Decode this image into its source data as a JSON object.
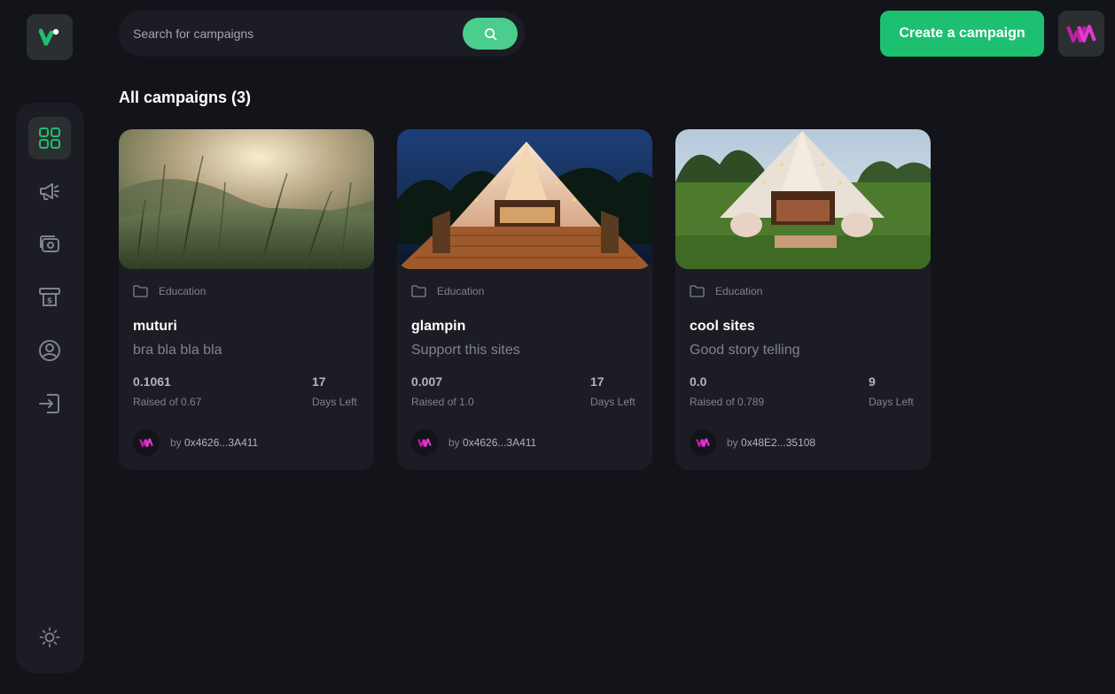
{
  "search": {
    "placeholder": "Search for campaigns"
  },
  "header": {
    "create_label": "Create a campaign"
  },
  "main": {
    "heading": "All campaigns (3)"
  },
  "colors": {
    "accent": "#1dc071",
    "search_button": "#4acd8d",
    "background": "#13131a",
    "card": "#1c1c24"
  },
  "sidebar": {
    "items": [
      {
        "icon": "dashboard-icon",
        "active": true
      },
      {
        "icon": "campaign-icon",
        "active": false
      },
      {
        "icon": "payment-icon",
        "active": false
      },
      {
        "icon": "withdraw-icon",
        "active": false
      },
      {
        "icon": "profile-icon",
        "active": false
      },
      {
        "icon": "logout-icon",
        "active": false
      }
    ],
    "theme_icon": "sun-icon"
  },
  "campaigns": [
    {
      "category": "Education",
      "title": "muturi",
      "description": "bra bla bla bla",
      "raised": "0.1061",
      "raised_label": "Raised of 0.67",
      "days": "17",
      "days_label": "Days Left",
      "by_prefix": "by",
      "owner": "0x4626...3A411"
    },
    {
      "category": "Education",
      "title": "glampin",
      "description": "Support this sites",
      "raised": "0.007",
      "raised_label": "Raised of 1.0",
      "days": "17",
      "days_label": "Days Left",
      "by_prefix": "by",
      "owner": "0x4626...3A411"
    },
    {
      "category": "Education",
      "title": "cool sites",
      "description": "Good story telling",
      "raised": "0.0",
      "raised_label": "Raised of 0.789",
      "days": "9",
      "days_label": "Days Left",
      "by_prefix": "by",
      "owner": "0x48E2...35108"
    }
  ]
}
